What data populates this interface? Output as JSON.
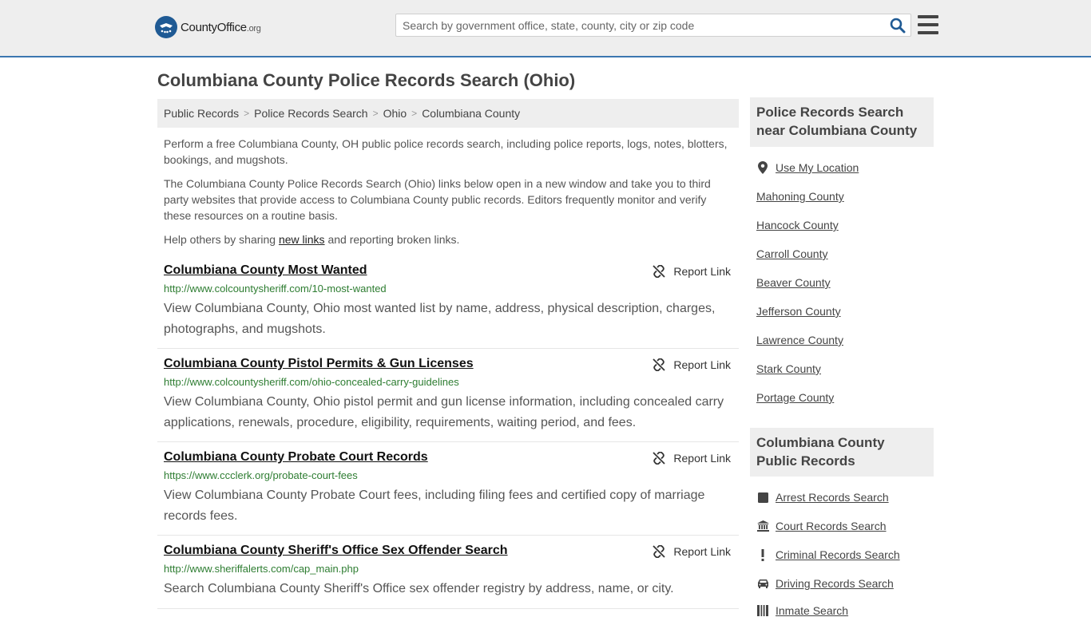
{
  "header": {
    "logo_text": "CountyOffice",
    "logo_suffix": ".org",
    "search_placeholder": "Search by government office, state, county, city or zip code"
  },
  "page_title": "Columbiana County Police Records Search (Ohio)",
  "breadcrumb": [
    "Public Records",
    "Police Records Search",
    "Ohio",
    "Columbiana County"
  ],
  "breadcrumb_separator": ">",
  "intro": {
    "p1": "Perform a free Columbiana County, OH public police records search, including police reports, logs, notes, blotters, bookings, and mugshots.",
    "p2": "The Columbiana County Police Records Search (Ohio) links below open in a new window and take you to third party websites that provide access to Columbiana County public records. Editors frequently monitor and verify these resources on a routine basis.",
    "p3_before": "Help others by sharing ",
    "p3_link": "new links",
    "p3_after": " and reporting broken links."
  },
  "report_label": "Report Link",
  "results": [
    {
      "title": "Columbiana County Most Wanted",
      "url": "http://www.colcountysheriff.com/10-most-wanted",
      "desc": "View Columbiana County, Ohio most wanted list by name, address, physical description, charges, photographs, and mugshots."
    },
    {
      "title": "Columbiana County Pistol Permits & Gun Licenses",
      "url": "http://www.colcountysheriff.com/ohio-concealed-carry-guidelines",
      "desc": "View Columbiana County, Ohio pistol permit and gun license information, including concealed carry applications, renewals, procedure, eligibility, requirements, waiting period, and fees."
    },
    {
      "title": "Columbiana County Probate Court Records",
      "url": "https://www.ccclerk.org/probate-court-fees",
      "desc": "View Columbiana County Probate Court fees, including filing fees and certified copy of marriage records fees."
    },
    {
      "title": "Columbiana County Sheriff's Office Sex Offender Search",
      "url": "http://www.sheriffalerts.com/cap_main.php",
      "desc": "Search Columbiana County Sheriff's Office sex offender registry by address, name, or city."
    }
  ],
  "sidebar": {
    "nearby_title": "Police Records Search near Columbiana County",
    "use_location": "Use My Location",
    "nearby": [
      "Mahoning County",
      "Hancock County",
      "Carroll County",
      "Beaver County",
      "Jefferson County",
      "Lawrence County",
      "Stark County",
      "Portage County"
    ],
    "public_title": "Columbiana County Public Records",
    "public_links": [
      {
        "label": "Arrest Records Search",
        "icon": "square-icon"
      },
      {
        "label": "Court Records Search",
        "icon": "courthouse-icon"
      },
      {
        "label": "Criminal Records Search",
        "icon": "exclamation-icon"
      },
      {
        "label": "Driving Records Search",
        "icon": "car-icon"
      },
      {
        "label": "Inmate Search",
        "icon": "inmate-icon"
      }
    ]
  },
  "colors": {
    "header_bg": "#eeeeee",
    "header_border": "#3b76b0",
    "url_green": "#2e7d32",
    "search_icon": "#1f5a94"
  }
}
